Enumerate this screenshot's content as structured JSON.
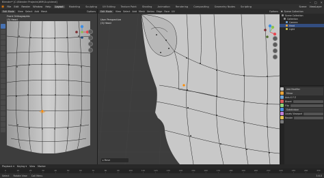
{
  "window": {
    "title": "Blender* [C:\\Blender Projects\\WM\\Guy.blend]",
    "controls": [
      "–",
      "□",
      "×"
    ]
  },
  "menubar": {
    "items": [
      "File",
      "Edit",
      "Render",
      "Window",
      "Help"
    ],
    "workspaces": [
      "Layout",
      "Modeling",
      "Sculpting",
      "UV Editing",
      "Texture Paint",
      "Shading",
      "Animation",
      "Rendering",
      "Compositing",
      "Geometry Nodes",
      "Scripting"
    ],
    "active_workspace": "Layout",
    "scene": "Scene",
    "view_layer": "ViewLayer"
  },
  "viewport_left": {
    "mode": "Edit Mode",
    "view_name": "Front Orthographic",
    "object_name": "(3) Head",
    "menu": [
      "View",
      "Select",
      "Add",
      "Mesh"
    ],
    "options": "Options"
  },
  "viewport_right": {
    "mode": "Edit Mode",
    "view_name": "User Perspective",
    "object_name": "(3) Head",
    "menu": [
      "View",
      "Select",
      "Add",
      "Mesh",
      "Vertex",
      "Edge",
      "Face",
      "UV"
    ],
    "options": "Options"
  },
  "hud": {
    "label": "▸ Move"
  },
  "outliner": {
    "header": "Scene Collection",
    "rows": [
      {
        "label": "Scene Collection",
        "color": "#8f8f8f",
        "selected": false
      },
      {
        "label": "Collection",
        "color": "#8f8f8f",
        "selected": false
      },
      {
        "label": "Camera",
        "color": "#6fa3d6",
        "selected": false
      },
      {
        "label": "Head",
        "color": "#e8a23a",
        "selected": true
      },
      {
        "label": "Light",
        "color": "#c9c24a",
        "selected": false
      }
    ]
  },
  "properties": {
    "header": "Add Modifier",
    "rows": [
      "Mirror",
      "Axis  X  Y  Z",
      "Bisect",
      "Flip",
      "Subdivision",
      "Levels Viewport",
      "Render"
    ],
    "tab_colors": [
      "#c0c0c0",
      "#e8a23a",
      "#6fa3d6",
      "#d95b5b",
      "#8fd37a",
      "#4a8fe0",
      "#c07fd8",
      "#e0c050",
      "#7a7a7a"
    ]
  },
  "timeline": {
    "items": [
      "Playback ▾",
      "Keying ▾",
      "View",
      "Marker"
    ],
    "frame_ticks": [
      "0",
      "10",
      "20",
      "30",
      "40",
      "50",
      "60",
      "70",
      "80",
      "90",
      "100",
      "110",
      "120",
      "130",
      "140",
      "150",
      "160",
      "170",
      "180",
      "190",
      "200",
      "210",
      "220",
      "230",
      "240",
      "250"
    ]
  },
  "status": {
    "items": [
      "Select",
      "Rotate View",
      "Call Menu"
    ],
    "version": "3.6.0"
  },
  "colors": {
    "accent": "#4772b3",
    "active_vertex": "#ff8a00",
    "mesh_surface": "#c9c9c9",
    "wire": "#1a1a1a",
    "axis_x": "#e8474f",
    "axis_y": "#8bc34a",
    "axis_z": "#3d8ee5"
  }
}
